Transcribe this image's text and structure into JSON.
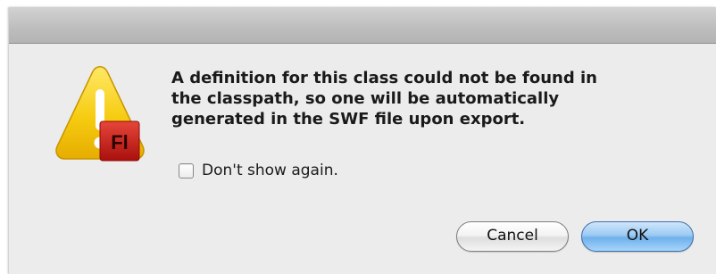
{
  "dialog": {
    "message": "A definition for this class could not be found in\nthe classpath, so one will be automatically\ngenerated in the SWF file upon export.",
    "checkbox": {
      "label": "Don't show again.",
      "checked": false
    },
    "buttons": {
      "cancel_label": "Cancel",
      "ok_label": "OK"
    },
    "icon": {
      "name": "flash-warning-icon",
      "badge_text": "Fl",
      "warning_color": "#f2c200",
      "badge_color": "#c4201c"
    }
  }
}
